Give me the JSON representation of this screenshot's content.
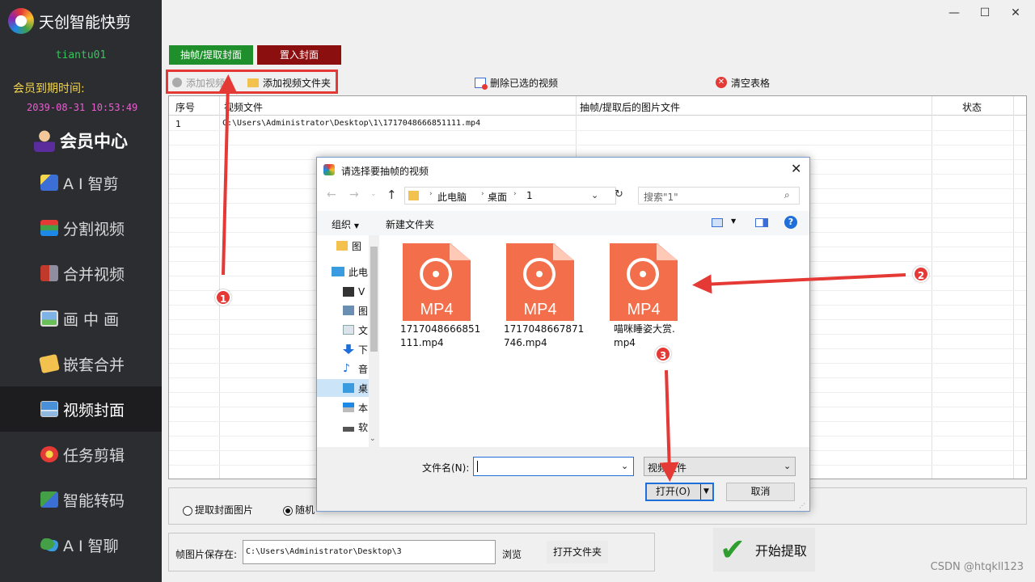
{
  "app": {
    "title": "天创智能快剪",
    "username": "tiantu01",
    "expiry_label": "会员到期时间:",
    "expiry_date": "2039-08-31 10:53:49",
    "member_center": "会员中心"
  },
  "nav": [
    {
      "label": "A I 智剪"
    },
    {
      "label": "分割视频"
    },
    {
      "label": "合并视频"
    },
    {
      "label": "画 中 画"
    },
    {
      "label": "嵌套合并"
    },
    {
      "label": "视频封面"
    },
    {
      "label": "任务剪辑"
    },
    {
      "label": "智能转码"
    },
    {
      "label": "A I 智聊"
    }
  ],
  "window": {
    "minimize": "—",
    "maximize": "☐",
    "close": "✕"
  },
  "tabs": {
    "extract": "抽帧/提取封面",
    "insert": "置入封面"
  },
  "toolbar": {
    "add_video": "添加视频",
    "add_folder": "添加视频文件夹",
    "delete_selected": "删除已选的视频",
    "clear_table": "清空表格"
  },
  "grid": {
    "columns": [
      "序号",
      "视频文件",
      "抽帧/提取后的图片文件",
      "状态"
    ],
    "rows": [
      {
        "index": "1",
        "file": "C:\\Users\\Administrator\\Desktop\\1\\1717048666851111.mp4",
        "output": "",
        "status": ""
      }
    ]
  },
  "options": {
    "opt1": "提取封面图片",
    "opt2": "随机"
  },
  "save": {
    "label": "帧图片保存在:",
    "path": "C:\\Users\\Administrator\\Desktop\\3",
    "browse": "浏览",
    "open_folder": "打开文件夹"
  },
  "start_button": "开始提取",
  "dialog": {
    "title": "请选择要抽帧的视频",
    "breadcrumb": [
      "此电脑",
      "桌面",
      "1"
    ],
    "search_placeholder": "搜索\"1\"",
    "organize": "组织",
    "new_folder": "新建文件夹",
    "tree": [
      {
        "label": "图"
      },
      {
        "label": "此电"
      },
      {
        "label": "V"
      },
      {
        "label": "图"
      },
      {
        "label": "文"
      },
      {
        "label": "下"
      },
      {
        "label": "音"
      },
      {
        "label": "桌"
      },
      {
        "label": "本"
      },
      {
        "label": "软"
      }
    ],
    "files": [
      {
        "name": "1717048666851111.mp4",
        "badge": "MP4"
      },
      {
        "name": "1717048667871746.mp4",
        "badge": "MP4"
      },
      {
        "name": "喵咪睡姿大赏.mp4",
        "badge": "MP4"
      }
    ],
    "filename_label": "文件名(N):",
    "filename_value": "",
    "filetype": "视频文件",
    "open": "打开(O)",
    "cancel": "取消"
  },
  "annotations": [
    "1",
    "2",
    "3"
  ],
  "watermark": "CSDN @htqkll123"
}
